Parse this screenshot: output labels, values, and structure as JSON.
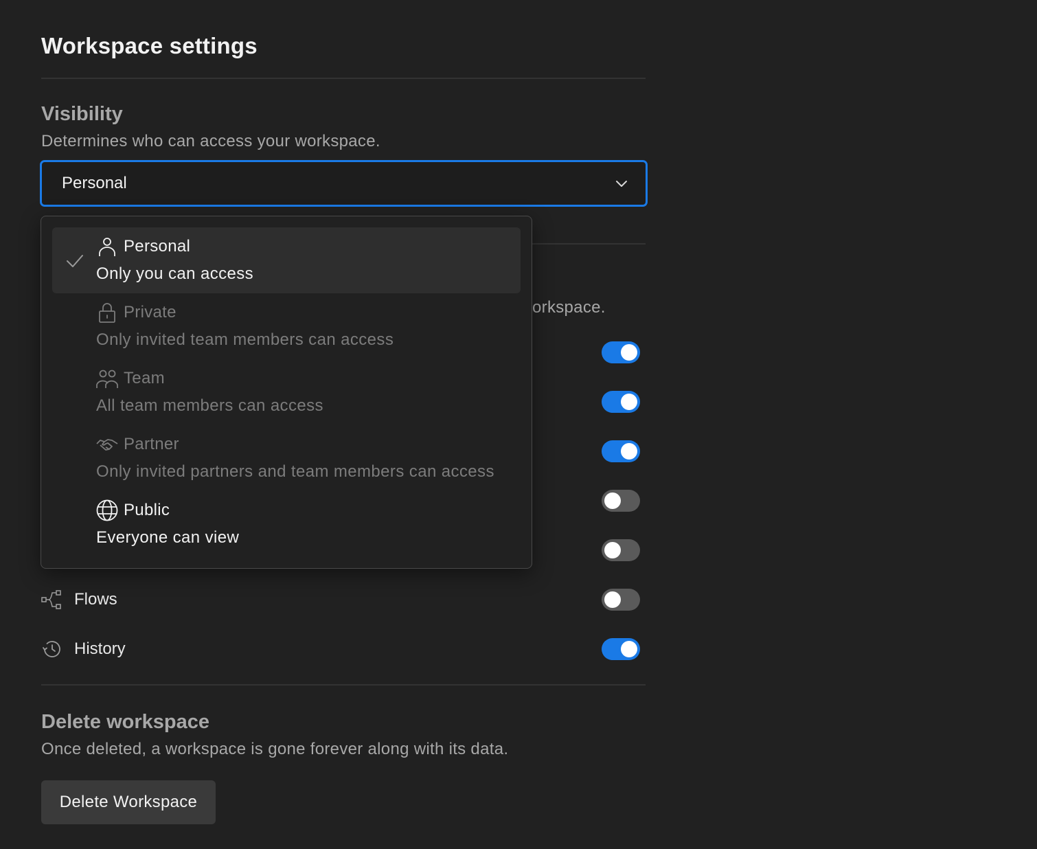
{
  "page": {
    "title": "Workspace settings"
  },
  "visibility": {
    "heading": "Visibility",
    "description": "Determines who can access your workspace.",
    "selected_value": "Personal",
    "options": [
      {
        "label": "Personal",
        "description": "Only you can access",
        "icon": "person-icon",
        "selected": true,
        "disabled": false
      },
      {
        "label": "Private",
        "description": "Only invited team members can access",
        "icon": "lock-icon",
        "selected": false,
        "disabled": true
      },
      {
        "label": "Team",
        "description": "All team members can access",
        "icon": "team-icon",
        "selected": false,
        "disabled": true
      },
      {
        "label": "Partner",
        "description": "Only invited partners and team members can access",
        "icon": "handshake-icon",
        "selected": false,
        "disabled": true
      },
      {
        "label": "Public",
        "description": "Everyone can view",
        "icon": "globe-icon",
        "selected": false,
        "disabled": false
      }
    ]
  },
  "features": {
    "partially_hidden_text": "orkspace.",
    "toggles": [
      {
        "state": "on"
      },
      {
        "state": "on"
      },
      {
        "state": "on"
      },
      {
        "state": "off"
      },
      {
        "state": "off"
      }
    ],
    "rows": [
      {
        "label": "Flows",
        "icon": "flows-icon",
        "state": "off"
      },
      {
        "label": "History",
        "icon": "history-icon",
        "state": "on"
      }
    ]
  },
  "delete_section": {
    "heading": "Delete workspace",
    "description": "Once deleted, a workspace is gone forever along with its data.",
    "button_label": "Delete Workspace"
  },
  "colors": {
    "accent": "#1a7ae6",
    "background": "#212121",
    "toggle_off": "#5a5a5a"
  }
}
